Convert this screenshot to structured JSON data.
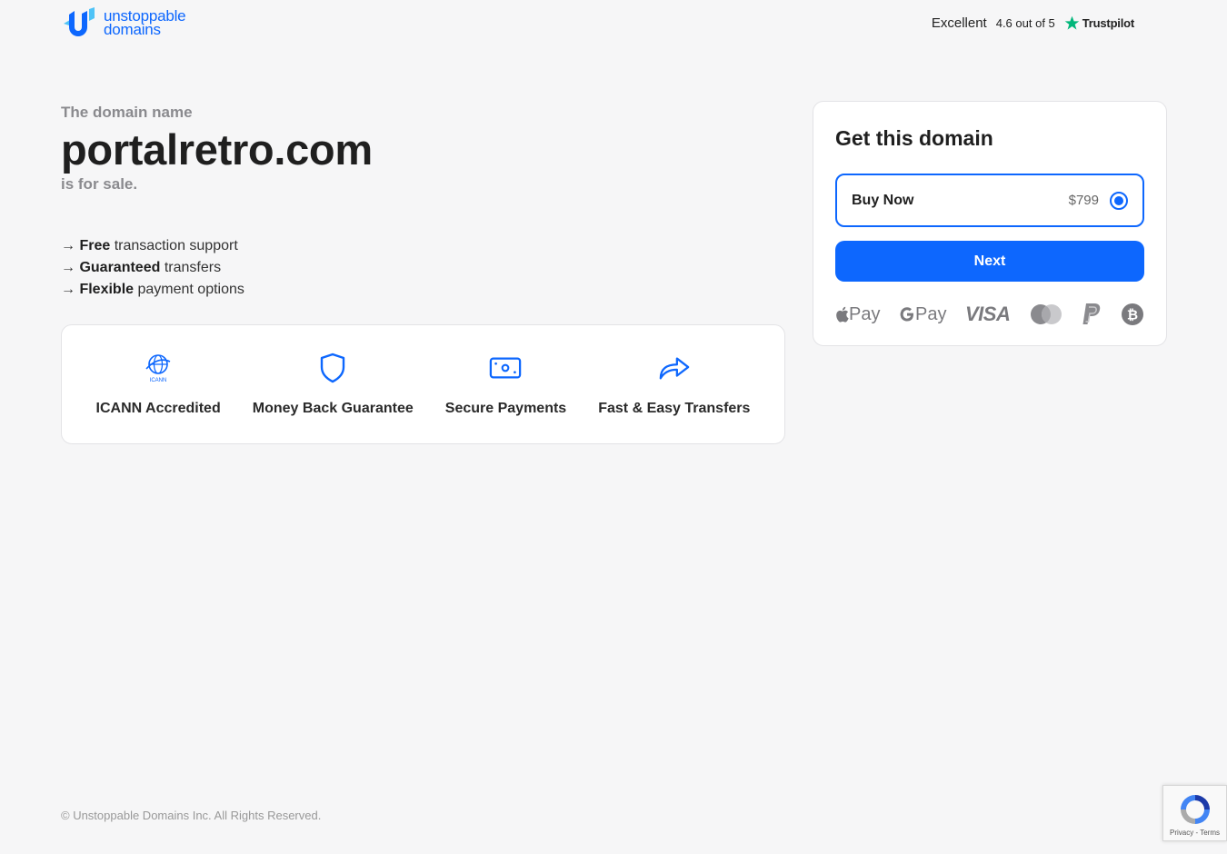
{
  "brand": {
    "line1": "unstoppable",
    "line2": "domains",
    "color": "#0d67fe"
  },
  "trustpilot": {
    "label": "Excellent",
    "rating": "4.6 out of 5",
    "name": "Trustpilot",
    "star_color": "#00b67a"
  },
  "hero": {
    "eyebrow": "The domain name",
    "domain": "portalretro.com",
    "sale": "is for sale."
  },
  "features": [
    {
      "arrow": "→",
      "bold": "Free",
      "rest": " transaction support"
    },
    {
      "arrow": "→",
      "bold": "Guaranteed",
      "rest": " transfers"
    },
    {
      "arrow": "→",
      "bold": "Flexible",
      "rest": " payment options"
    }
  ],
  "badges": [
    {
      "icon": "icann-globe-icon",
      "label": "ICANN Accredited",
      "icon_text": "ICANN"
    },
    {
      "icon": "shield-icon",
      "label": "Money Back Guarantee"
    },
    {
      "icon": "money-bill-icon",
      "label": "Secure Payments"
    },
    {
      "icon": "share-arrow-icon",
      "label": "Fast & Easy Transfers"
    }
  ],
  "card": {
    "title": "Get this domain",
    "option_label": "Buy Now",
    "option_price": "$799",
    "next_label": "Next",
    "payments": {
      "apple_pay": "Pay",
      "google_pay": "Pay",
      "visa": "VISA"
    }
  },
  "footer": {
    "copyright": "© Unstoppable Domains Inc. All Rights Reserved."
  },
  "recaptcha": {
    "links": "Privacy - Terms"
  }
}
